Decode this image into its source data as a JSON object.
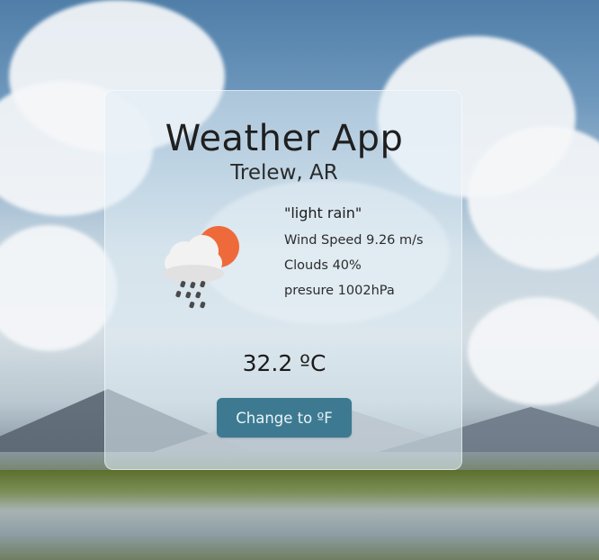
{
  "app": {
    "title": "Weather App",
    "location": "Trelew, AR"
  },
  "weather": {
    "description": "\"light rain\"",
    "wind_speed": "Wind Speed 9.26 m/s",
    "clouds": "Clouds 40%",
    "pressure": "presure 1002hPa",
    "temperature": "32.2 ºC",
    "icon": "light-rain-cloud-sun-icon"
  },
  "actions": {
    "toggle_units_label": "Change to ºF"
  },
  "colors": {
    "button_bg": "#3d7a92",
    "button_text": "#eaf3f6",
    "sun": "#ef6a3a",
    "cloud": "#f2f2f2",
    "rain": "#4a4a4a"
  }
}
